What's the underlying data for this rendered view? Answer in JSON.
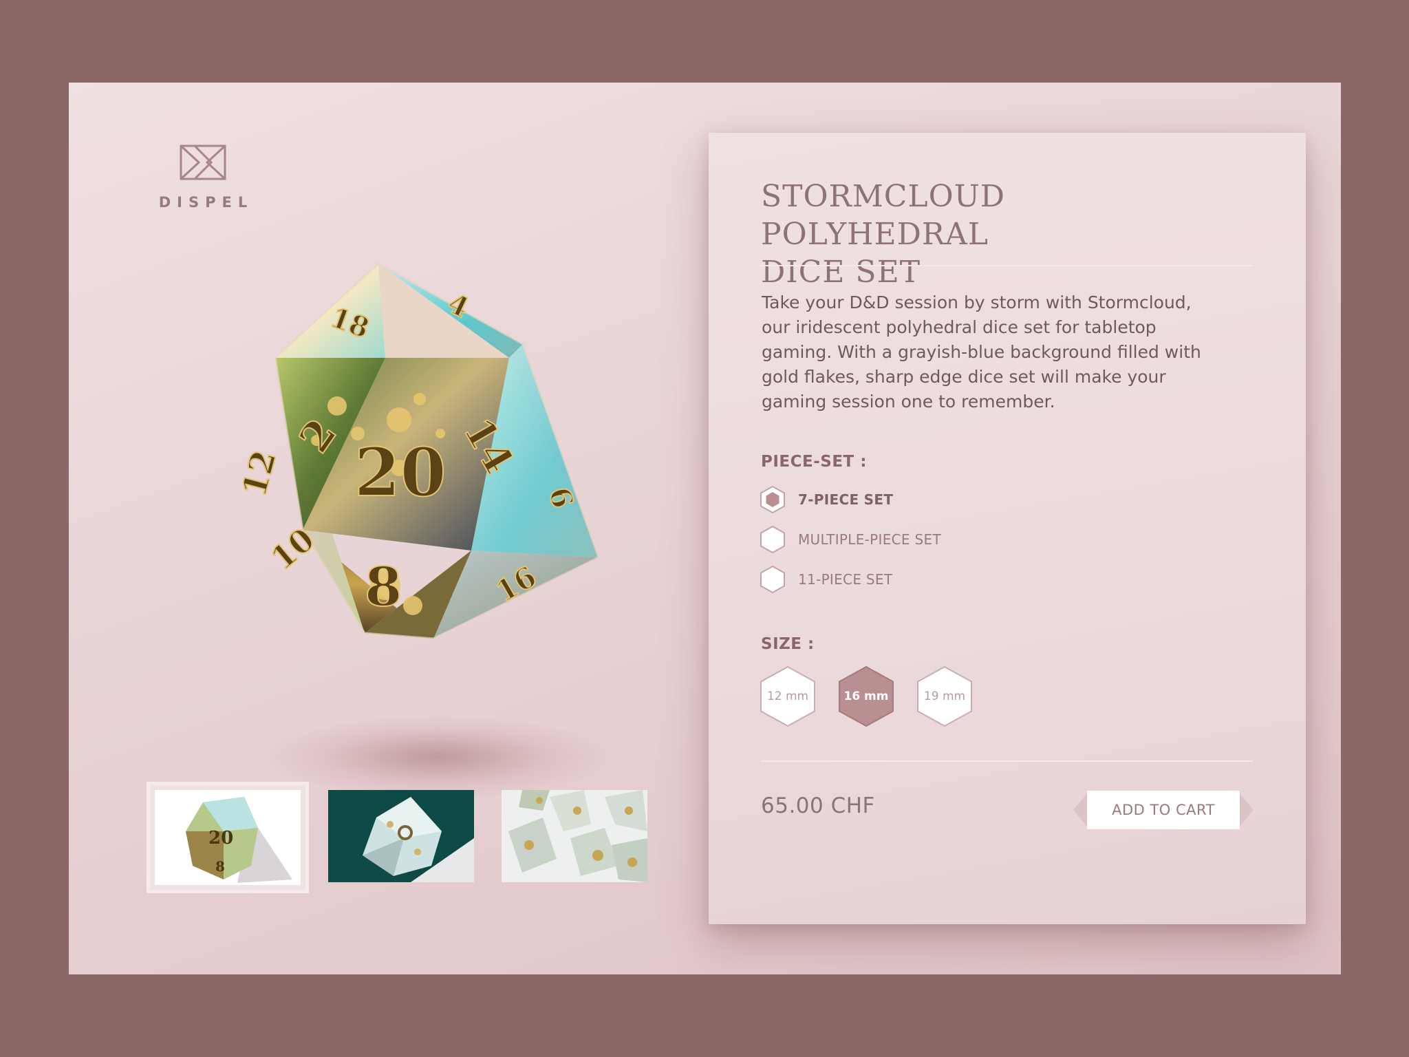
{
  "brand": {
    "name": "DISPEL",
    "logo_icon": "dispel-logo-icon"
  },
  "product": {
    "title_line1": "STORMCLOUD POLYHEDRAL",
    "title_line2": "DICE SET",
    "description": "Take your D&D session by storm with Stormcloud, our iridescent polyhedral dice set for tabletop gaming. With a grayish-blue background filled with gold flakes, sharp edge dice set will make your gaming session one to remember.",
    "price": "65.00 CHF"
  },
  "hero_image": {
    "face_numbers": [
      "20",
      "8",
      "2",
      "14",
      "18",
      "4",
      "6",
      "10",
      "16",
      "12"
    ]
  },
  "thumbnails": [
    {
      "id": 1,
      "selected": true
    },
    {
      "id": 2,
      "selected": false
    },
    {
      "id": 3,
      "selected": false
    }
  ],
  "piece_set": {
    "label": "PIECE-SET :",
    "options": [
      {
        "label": "7-PIECE SET",
        "selected": true
      },
      {
        "label": "MULTIPLE-PIECE SET",
        "selected": false
      },
      {
        "label": "11-PIECE SET",
        "selected": false
      }
    ]
  },
  "size": {
    "label": "SIZE :",
    "options": [
      {
        "label": "12 mm",
        "selected": false
      },
      {
        "label": "16 mm",
        "selected": true
      },
      {
        "label": "19 mm",
        "selected": false
      }
    ]
  },
  "cart": {
    "button_label": "ADD TO CART"
  },
  "colors": {
    "page_background": "#8c6767",
    "card_background": "#ecdcde",
    "accent": "#b98f92",
    "text_muted": "#9a7b7d",
    "text_body": "#6f5a5b"
  }
}
